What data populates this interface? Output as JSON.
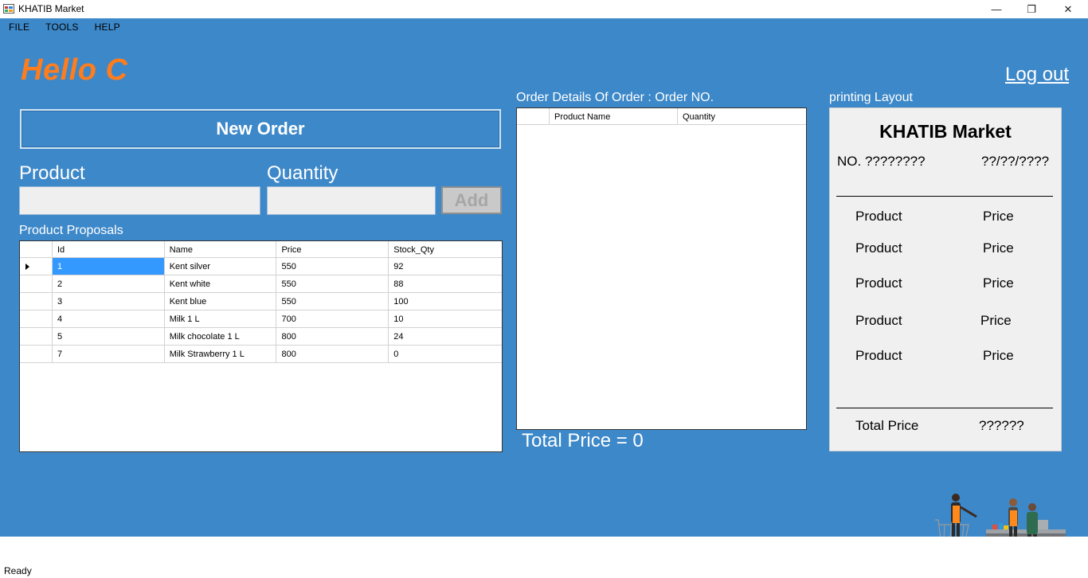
{
  "window": {
    "title": "KHATIB Market",
    "minimize_glyph": "—",
    "maximize_glyph": "❐",
    "close_glyph": "✕"
  },
  "menu": {
    "items": [
      "FILE",
      "TOOLS",
      "HELP"
    ]
  },
  "header": {
    "greeting": "Hello C",
    "logout_label": "Log out"
  },
  "order_form": {
    "new_order_label": "New Order",
    "product_label": "Product",
    "product_value": "",
    "quantity_label": "Quantity",
    "quantity_value": "",
    "add_label": "Add"
  },
  "proposals": {
    "label": "Product Proposals",
    "columns": [
      "Id",
      "Name",
      "Price",
      "Stock_Qty"
    ],
    "rows": [
      {
        "id": "1",
        "name": "Kent silver",
        "price": "550",
        "stock": "92"
      },
      {
        "id": "2",
        "name": "Kent white",
        "price": "550",
        "stock": "88"
      },
      {
        "id": "3",
        "name": "Kent blue",
        "price": "550",
        "stock": "100"
      },
      {
        "id": "4",
        "name": "Milk 1 L",
        "price": "700",
        "stock": "10"
      },
      {
        "id": "5",
        "name": "Milk chocolate 1 L",
        "price": "800",
        "stock": "24"
      },
      {
        "id": "7",
        "name": "Milk Strawberry 1 L",
        "price": "800",
        "stock": "0"
      }
    ],
    "selected_row": 0
  },
  "order_details": {
    "label": "Order Details Of Order : Order NO.",
    "columns": [
      "Product Name",
      "Quantity"
    ],
    "total_label": "Total Price = 0"
  },
  "printing": {
    "label": "printing Layout",
    "title": "KHATIB Market",
    "number": "NO. ????????",
    "date": "??/??/????",
    "items": [
      {
        "product": "Product",
        "price": "Price"
      },
      {
        "product": "Product",
        "price": "Price"
      },
      {
        "product": "Product",
        "price": "Price"
      },
      {
        "product": "Product",
        "price": "Price"
      },
      {
        "product": "Product",
        "price": "Price"
      }
    ],
    "total_label": "Total Price",
    "total_value": "??????"
  },
  "status": {
    "text": "Ready"
  },
  "colors": {
    "background": "#3d88c9",
    "greeting": "#ff7d1c",
    "selection": "#3399ff"
  },
  "icons": {
    "app": "app-window-icon",
    "illustration": "shoppers-checkout-illustration"
  }
}
